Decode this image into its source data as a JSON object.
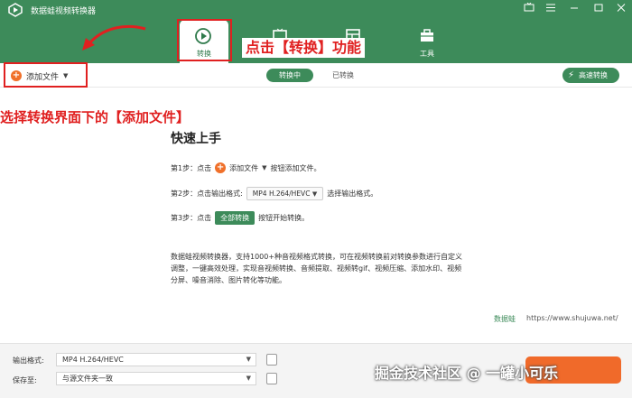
{
  "window": {
    "title": "数据蛙视频转换器",
    "controls": [
      "ad-icon",
      "menu-icon",
      "minimize-icon",
      "maximize-icon",
      "close-icon"
    ]
  },
  "tabs": [
    {
      "label": "转换",
      "icon": "convert-icon",
      "active": true
    },
    {
      "label": "",
      "icon": "media-icon",
      "active": false
    },
    {
      "label": "",
      "icon": "layout-icon",
      "active": false
    },
    {
      "label": "工具",
      "icon": "toolbox-icon",
      "active": false
    }
  ],
  "toolbar": {
    "add_file_label": "添加文件",
    "segment_converting": "转换中",
    "segment_converted": "已转换",
    "speed_label": "高速转换"
  },
  "annotations": {
    "tab_hint": "点击【转换】功能",
    "add_hint": "选择转换界面下的【添加文件】"
  },
  "quickstart": {
    "title": "快速上手",
    "step1_prefix": "第1步：点击",
    "step1_button": "添加文件",
    "step1_suffix": "按钮添加文件。",
    "step2_prefix": "第2步：点击输出格式:",
    "step2_format": "MP4 H.264/HEVC",
    "step2_suffix": "选择输出格式。",
    "step3_prefix": "第3步：点击",
    "step3_button": "全部转换",
    "step3_suffix": "按钮开始转换。",
    "description": "数据蛙视频转换器，支持1000+种音视频格式转换，可在视频转换前对转换参数进行自定义调整，一键高效处理，实现音视频转换、音频提取、视频转gif、视频压缩、添加水印、视频分屏、噪音消除、图片转化等功能。",
    "brand": "数据蛙",
    "site": "https://www.shujuwa.net/"
  },
  "bottom": {
    "output_label": "输出格式:",
    "output_value": "MP4 H.264/HEVC",
    "save_label": "保存至:",
    "save_value": "与源文件夹一致"
  },
  "watermark": "掘金技术社区 @ 一罐小可乐",
  "colors": {
    "brand_green": "#3d8b5a",
    "accent_orange": "#f06a2a",
    "annotation_red": "#e02020"
  }
}
